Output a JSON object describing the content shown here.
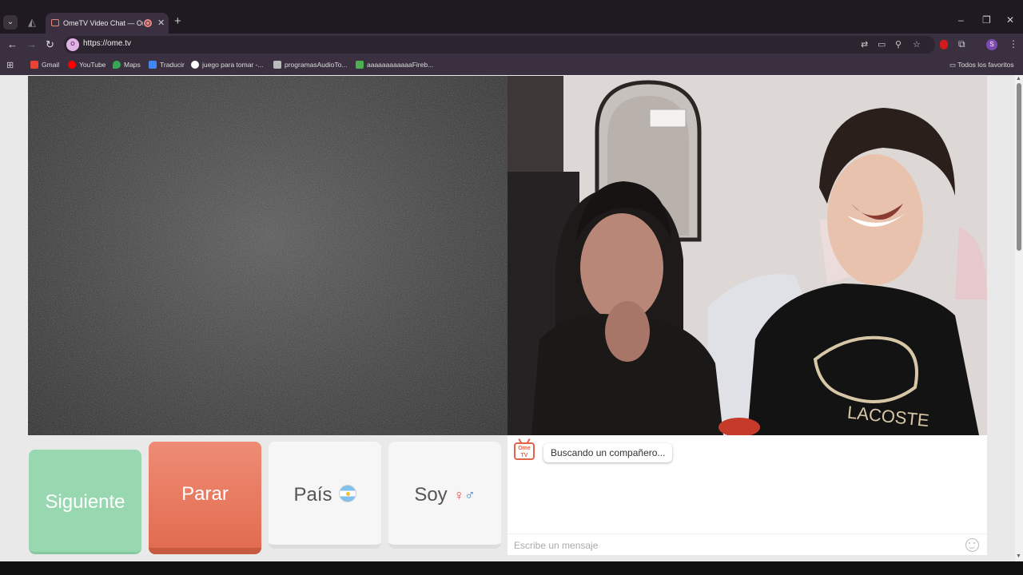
{
  "browser": {
    "tab_title": "OmeTV Video Chat — Ome",
    "url": "https://ome.tv",
    "profile_initial": "S",
    "bookmarks": [
      {
        "label": "Gmail",
        "color": "#ea4335"
      },
      {
        "label": "YouTube",
        "color": "#ff0000"
      },
      {
        "label": "Maps",
        "color": "#34a853"
      },
      {
        "label": "Traducir",
        "color": "#4285f4"
      },
      {
        "label": "juego para tomar -...",
        "color": "#ffffff"
      },
      {
        "label": "programasAudioTo...",
        "color": "#bbbbbb"
      },
      {
        "label": "aaaaaaaaaaaaFireb...",
        "color": "#4caf50"
      }
    ],
    "all_bookmarks_label": "Todos los favoritos"
  },
  "controls": {
    "next_label": "Siguiente",
    "stop_label": "Parar",
    "country_label": "País",
    "soy_label": "Soy"
  },
  "chat": {
    "logo_text": "Ome TV",
    "status_message": "Buscando un compañero...",
    "input_placeholder": "Escribe un mensaje"
  },
  "colors": {
    "next_button": "#97d8b1",
    "stop_button": "#e26c50",
    "accent": "#e0664a"
  }
}
